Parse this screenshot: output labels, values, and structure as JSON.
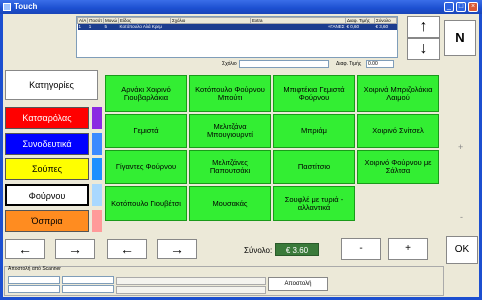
{
  "window": {
    "title": "Touch",
    "minimize_glyph": "_",
    "maximize_glyph": "□",
    "close_glyph": "×"
  },
  "order": {
    "columns": [
      "A/A",
      "Ποσότ",
      "Μονώ",
      "Είδος",
      "Σχόλιο",
      "Extra",
      "Διαφ. Τιμής",
      "Σύνολο"
    ],
    "rows": [
      [
        "1",
        "1",
        "5",
        "Κοτόπουλο Αλά Κρεμ",
        "",
        "+ΓΑΝΕΣ",
        "€ 0,60",
        "€ 3,60"
      ]
    ]
  },
  "controls": {
    "up_glyph": "↑",
    "down_glyph": "↓",
    "n_label": "N",
    "comment_label": "Σχόλιο",
    "comment_value": "",
    "price_diff_label": "Διαφ. Τιμής",
    "price_diff_value": "0.00"
  },
  "categories": {
    "title": "Κατηγορίες",
    "items": [
      {
        "label": "Κατσαρόλας",
        "bg": "#ff0000",
        "fg": "#ffffff",
        "swatch": "#8b2be2"
      },
      {
        "label": "Συνοδευτικά",
        "bg": "#0000ff",
        "fg": "#ffffff",
        "swatch": "#3c8bff"
      },
      {
        "label": "Σούπες",
        "bg": "#ffff00",
        "fg": "#000000",
        "swatch": "#1e90ff"
      },
      {
        "label": "Φούρνου",
        "bg": "#ffffff",
        "fg": "#000000",
        "swatch": "#a9d8ff"
      },
      {
        "label": "Όσπρια",
        "bg": "#ff8c20",
        "fg": "#000000",
        "swatch": "#ff9a9a"
      }
    ]
  },
  "products": [
    "Αρνάκι Χοιρινό Γιουβαρλάκια",
    "Κοτόπουλο Φούρνου Μπούτι",
    "Μπιφτέκια Γεμιστά Φούρνου",
    "Χοιρινά Μπριζολάκια Λαιμού",
    "Γεμιστά",
    "Μελιτζάνα Μπουγιουρντί",
    "Μπριάμ",
    "Χοιρινό Σνίτσελ",
    "Γίγαντες Φούρνου",
    "Μελιτζάνες Παπουτσάκι",
    "Παστίτσιο",
    "Χοιρινό Φούρνου με Σάλτσα",
    "Κοτόπουλο Γιουβέτσι",
    "Μουσακάς",
    "Σουφλέ με τυριά - αλλαντικά"
  ],
  "bottom": {
    "left_glyph": "←",
    "right_glyph": "→",
    "total_label": "Σύνολο:",
    "total_value": "€ 3.60",
    "minus_label": "-",
    "plus_label": "+",
    "ok_label": "OK",
    "side_plus": "+",
    "side_minus": "-"
  },
  "scanner": {
    "label": "Αποστολή από Scanner",
    "send_label": "Αποστολή"
  }
}
